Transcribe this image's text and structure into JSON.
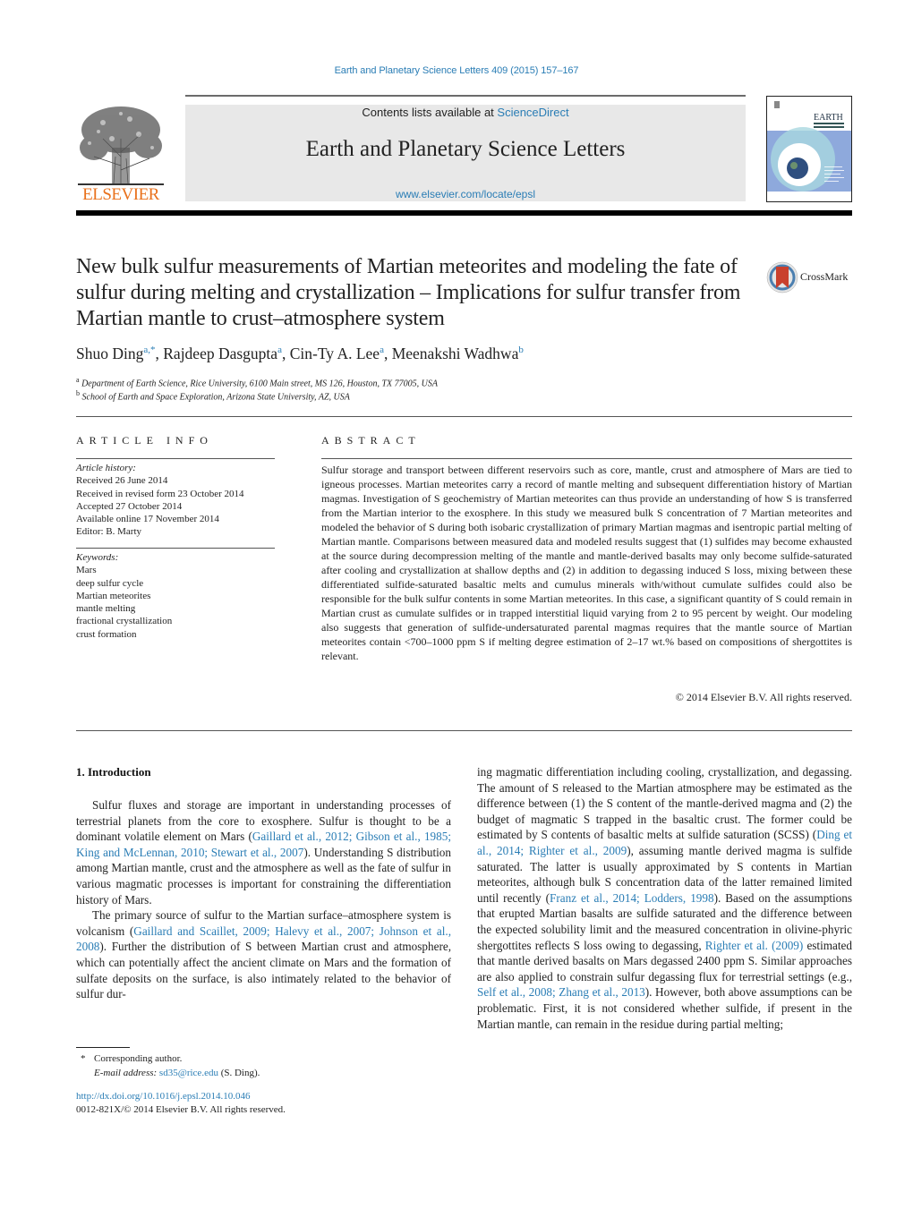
{
  "header": {
    "citation": "Earth and Planetary Science Letters 409 (2015) 157–167",
    "contents_prefix": "Contents lists available at ",
    "contents_link": "ScienceDirect",
    "journal_name": "Earth and Planetary Science Letters",
    "journal_url": "www.elsevier.com/locate/epsl",
    "publisher": "ELSEVIER",
    "cover_title": "EARTH",
    "cover_subtitle": "& PLANETARY SCIENCE LETTERS",
    "crossmark_label": "CrossMark"
  },
  "article": {
    "title": "New bulk sulfur measurements of Martian meteorites and modeling the fate of sulfur during melting and crystallization – Implications for sulfur transfer from Martian mantle to crust–atmosphere system",
    "authors": [
      {
        "name": "Shuo Ding",
        "sup": "a,*"
      },
      {
        "name": "Rajdeep Dasgupta",
        "sup": "a"
      },
      {
        "name": "Cin-Ty A. Lee",
        "sup": "a"
      },
      {
        "name": "Meenakshi Wadhwa",
        "sup": "b"
      }
    ],
    "affiliations": [
      {
        "sup": "a",
        "text": "Department of Earth Science, Rice University, 6100 Main street, MS 126, Houston, TX 77005, USA"
      },
      {
        "sup": "b",
        "text": "School of Earth and Space Exploration, Arizona State University, AZ, USA"
      }
    ]
  },
  "article_info": {
    "heading": "ARTICLE INFO",
    "history_label": "Article history:",
    "history": [
      "Received 26 June 2014",
      "Received in revised form 23 October 2014",
      "Accepted 27 October 2014",
      "Available online 17 November 2014",
      "Editor: B. Marty"
    ],
    "keywords_label": "Keywords:",
    "keywords": [
      "Mars",
      "deep sulfur cycle",
      "Martian meteorites",
      "mantle melting",
      "fractional crystallization",
      "crust formation"
    ]
  },
  "abstract": {
    "heading": "ABSTRACT",
    "text": "Sulfur storage and transport between different reservoirs such as core, mantle, crust and atmosphere of Mars are tied to igneous processes. Martian meteorites carry a record of mantle melting and subsequent differentiation history of Martian magmas. Investigation of S geochemistry of Martian meteorites can thus provide an understanding of how S is transferred from the Martian interior to the exosphere. In this study we measured bulk S concentration of 7 Martian meteorites and modeled the behavior of S during both isobaric crystallization of primary Martian magmas and isentropic partial melting of Martian mantle. Comparisons between measured data and modeled results suggest that (1) sulfides may become exhausted at the source during decompression melting of the mantle and mantle-derived basalts may only become sulfide-saturated after cooling and crystallization at shallow depths and (2) in addition to degassing induced S loss, mixing between these differentiated sulfide-saturated basaltic melts and cumulus minerals with/without cumulate sulfides could also be responsible for the bulk sulfur contents in some Martian meteorites. In this case, a significant quantity of S could remain in Martian crust as cumulate sulfides or in trapped interstitial liquid varying from 2 to 95 percent by weight. Our modeling also suggests that generation of sulfide-undersaturated parental magmas requires that the mantle source of Martian meteorites contain <700–1000 ppm S if melting degree estimation of 2–17 wt.% based on compositions of shergottites is relevant.",
    "copyright": "© 2014 Elsevier B.V. All rights reserved."
  },
  "body": {
    "section_heading": "1. Introduction",
    "p1": [
      {
        "t": "Sulfur fluxes and storage are important in understanding processes of terrestrial planets from the core to exosphere. Sulfur is thought to be a dominant volatile element on Mars ("
      },
      {
        "t": "Gaillard et al., 2012; Gibson et al., 1985; King and McLennan, 2010; Stewart et al., 2007",
        "link": true
      },
      {
        "t": "). Understanding S distribution among Martian mantle, crust and the atmosphere as well as the fate of sulfur in various magmatic processes is important for constraining the differentiation history of Mars."
      }
    ],
    "p2": [
      {
        "t": "The primary source of sulfur to the Martian surface–atmosphere system is volcanism ("
      },
      {
        "t": "Gaillard and Scaillet, 2009; Halevy et al., 2007; Johnson et al., 2008",
        "link": true
      },
      {
        "t": "). Further the distribution of S between Martian crust and atmosphere, which can potentially affect the ancient climate on Mars and the formation of sulfate deposits on the surface, is also intimately related to the behavior of sulfur dur-"
      }
    ],
    "p3": [
      {
        "t": "ing magmatic differentiation including cooling, crystallization, and degassing. The amount of S released to the Martian atmosphere may be estimated as the difference between (1) the S content of the mantle-derived magma and (2) the budget of magmatic S trapped in the basaltic crust. The former could be estimated by S contents of basaltic melts at sulfide saturation (SCSS) ("
      },
      {
        "t": "Ding et al., 2014; Righter et al., 2009",
        "link": true
      },
      {
        "t": "), assuming mantle derived magma is sulfide saturated. The latter is usually approximated by S contents in Martian meteorites, although bulk S concentration data of the latter remained limited until recently ("
      },
      {
        "t": "Franz et al., 2014; Lodders, 1998",
        "link": true
      },
      {
        "t": "). Based on the assumptions that erupted Martian basalts are sulfide saturated and the difference between the expected solubility limit and the measured concentration in olivine-phyric shergottites reflects S loss owing to degassing, "
      },
      {
        "t": "Righter et al. (2009)",
        "link": true
      },
      {
        "t": " estimated that mantle derived basalts on Mars degassed 2400 ppm S. Similar approaches are also applied to constrain sulfur degassing flux for terrestrial settings (e.g., "
      },
      {
        "t": "Self et al., 2008; Zhang et al., 2013",
        "link": true
      },
      {
        "t": "). However, both above assumptions can be problematic. First, it is not considered whether sulfide, if present in the Martian mantle, can remain in the residue during partial melting;"
      }
    ]
  },
  "footnotes": {
    "star": "*",
    "corresponding": "Corresponding author.",
    "email_label": "E-mail address:",
    "email": "sd35@rice.edu",
    "email_suffix": " (S. Ding).",
    "doi": "http://dx.doi.org/10.1016/j.epsl.2014.10.046",
    "issn": "0012-821X/© 2014 Elsevier B.V. All rights reserved."
  },
  "colors": {
    "link": "#2a7db5",
    "elsevier_orange": "#e9711c",
    "banner_bg": "#e8e8e8"
  }
}
